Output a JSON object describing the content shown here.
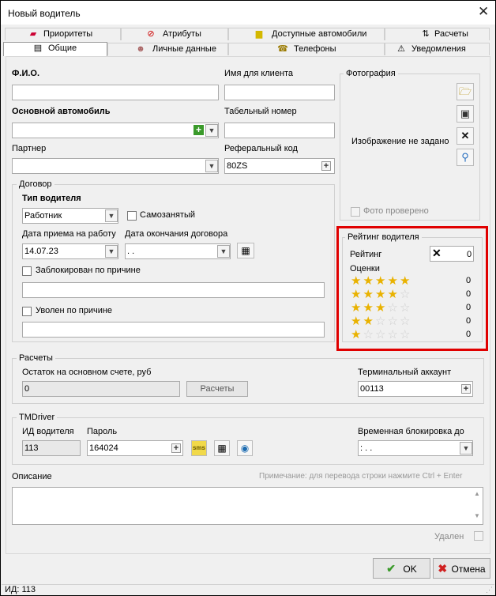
{
  "window": {
    "title": "Новый водитель"
  },
  "tabs_row1": [
    {
      "label": "Приоритеты",
      "icon": "priority-icon"
    },
    {
      "label": "Атрибуты",
      "icon": "no-smoking-icon"
    },
    {
      "label": "Доступные автомобили",
      "icon": "taxi-icon"
    },
    {
      "label": "Расчеты",
      "icon": "sort-arrows-icon"
    }
  ],
  "tabs_row2": [
    {
      "label": "Общие",
      "icon": "general-icon",
      "active": true
    },
    {
      "label": "Личные данные",
      "icon": "person-icon"
    },
    {
      "label": "Телефоны",
      "icon": "phone-icon"
    },
    {
      "label": "Уведомления",
      "icon": "warning-icon"
    }
  ],
  "main": {
    "fio_label": "Ф.И.О.",
    "fio_value": "",
    "client_name_label": "Имя для клиента",
    "client_name_value": "",
    "main_car_label": "Основной автомобиль",
    "main_car_value": "",
    "tab_number_label": "Табельный номер",
    "tab_number_value": "",
    "partner_label": "Партнер",
    "partner_value": "",
    "referral_label": "Реферальный код",
    "referral_value": "80ZS"
  },
  "contract": {
    "group_title": "Договор",
    "driver_type_label": "Тип водителя",
    "driver_type_value": "Работник",
    "self_employed_label": "Самозанятый",
    "hire_date_label": "Дата приема на работу",
    "hire_date_value": "14.07.23",
    "end_date_label": "Дата окончания договора",
    "end_date_value": ". .",
    "blocked_label": "Заблокирован по причине",
    "blocked_value": "",
    "fired_label": "Уволен по причине",
    "fired_value": ""
  },
  "photo": {
    "group_title": "Фотография",
    "no_image_text": "Изображение не задано",
    "verified_label": "Фото проверено",
    "buttons": [
      "open-folder-icon",
      "save-icon",
      "delete-x-icon",
      "magnifier-icon"
    ]
  },
  "rating": {
    "group_title": "Рейтинг водителя",
    "rating_label": "Рейтинг",
    "rating_value": "0",
    "grades_label": "Оценки",
    "grades": [
      {
        "stars": 5,
        "count": "0"
      },
      {
        "stars": 4,
        "count": "0"
      },
      {
        "stars": 3,
        "count": "0"
      },
      {
        "stars": 2,
        "count": "0"
      },
      {
        "stars": 1,
        "count": "0"
      }
    ]
  },
  "settlements": {
    "group_title": "Расчеты",
    "balance_label": "Остаток на основном счете, руб",
    "balance_value": "0",
    "button_label": "Расчеты",
    "terminal_label": "Терминальный аккаунт",
    "terminal_value": "00113"
  },
  "tmdriver": {
    "group_title": "TMDriver",
    "driver_id_label": "ИД водителя",
    "driver_id_value": "113",
    "password_label": "Пароль",
    "password_value": "164024",
    "temp_block_label": "Временная блокировка до",
    "temp_block_value": ":    .   ."
  },
  "description": {
    "label": "Описание",
    "hint": "Примечание: для перевода строки нажмите Ctrl + Enter",
    "value": "",
    "deleted_label": "Удален"
  },
  "footer": {
    "ok_label": "OK",
    "cancel_label": "Отмена"
  },
  "status": {
    "id_text": "ИД: 113"
  },
  "colors": {
    "highlight_border": "#e00000",
    "star_on": "#e9b200",
    "star_off": "#cfcfcf"
  }
}
